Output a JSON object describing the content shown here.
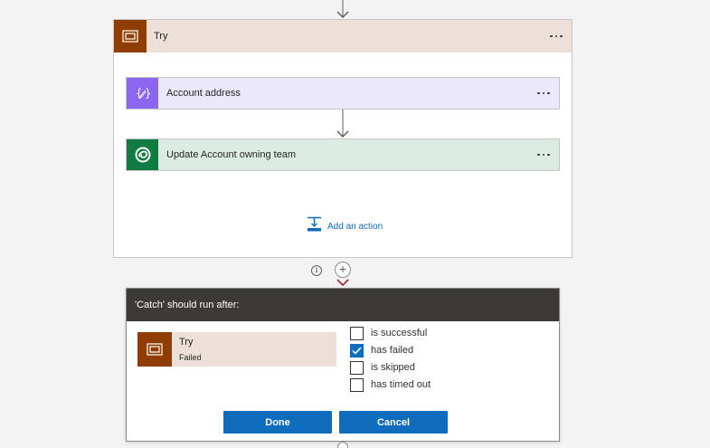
{
  "scope": {
    "title": "Try",
    "icon": "scope-icon",
    "color": "#8f3d00",
    "header_bg": "#ede0d8"
  },
  "actions": [
    {
      "title": "Account address",
      "icon": "compose-icon",
      "color": "#8c66f0",
      "bg": "#ece8fc"
    },
    {
      "title": "Update Account owning team",
      "icon": "dataverse-icon",
      "color": "#107c41",
      "bg": "#dcece4"
    }
  ],
  "add_action": {
    "label": "Add an action",
    "icon": "add-action-icon"
  },
  "connector": {
    "info_icon": "i",
    "plus_icon": "+"
  },
  "run_after_dialog": {
    "title": "'Catch' should run after:",
    "predecessor": {
      "name": "Try",
      "status": "Failed"
    },
    "options": [
      {
        "label": "is successful",
        "checked": false
      },
      {
        "label": "has failed",
        "checked": true
      },
      {
        "label": "is skipped",
        "checked": false
      },
      {
        "label": "has timed out",
        "checked": false
      }
    ],
    "done_label": "Done",
    "cancel_label": "Cancel",
    "button_color": "#0f6cbd"
  }
}
